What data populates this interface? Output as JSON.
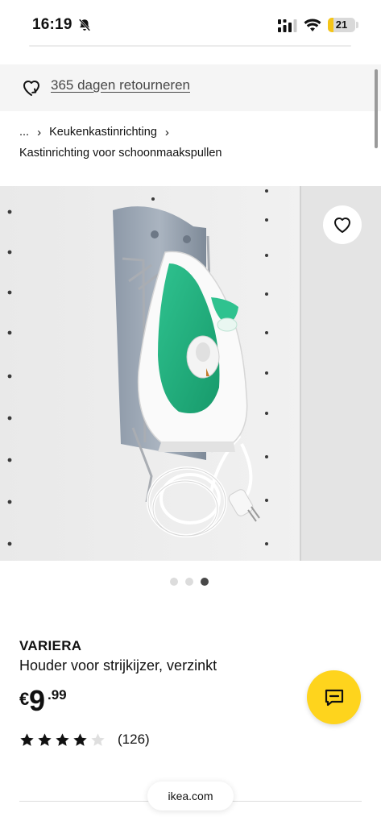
{
  "status_bar": {
    "time": "16:19",
    "battery_level": "21",
    "icons": [
      "bell-off-icon",
      "signal-icon",
      "wifi-icon",
      "battery-icon"
    ]
  },
  "returns_banner": {
    "text": "365 dagen retourneren",
    "icon": "returns-heart-icon"
  },
  "breadcrumb": {
    "ellipsis": "...",
    "separator": "›",
    "parent": "Keukenkastinrichting",
    "current": "Kastinrichting voor schoonmaakspullen"
  },
  "gallery": {
    "image_count": 3,
    "active_index": 2,
    "wishlist_icon": "heart-icon"
  },
  "product": {
    "name": "VARIERA",
    "description": "Houder voor strijkijzer, verzinkt",
    "price": {
      "currency": "€",
      "integer": "9",
      "decimal": ".99"
    },
    "rating": {
      "stars": 4,
      "max": 5,
      "review_count": "(126)"
    }
  },
  "chat_button": {
    "icon": "chat-icon",
    "color": "#FED41D"
  },
  "browser": {
    "url": "ikea.com"
  },
  "colors": {
    "accent_yellow": "#FED41D",
    "iron_green": "#22A87A",
    "text": "#111111"
  }
}
